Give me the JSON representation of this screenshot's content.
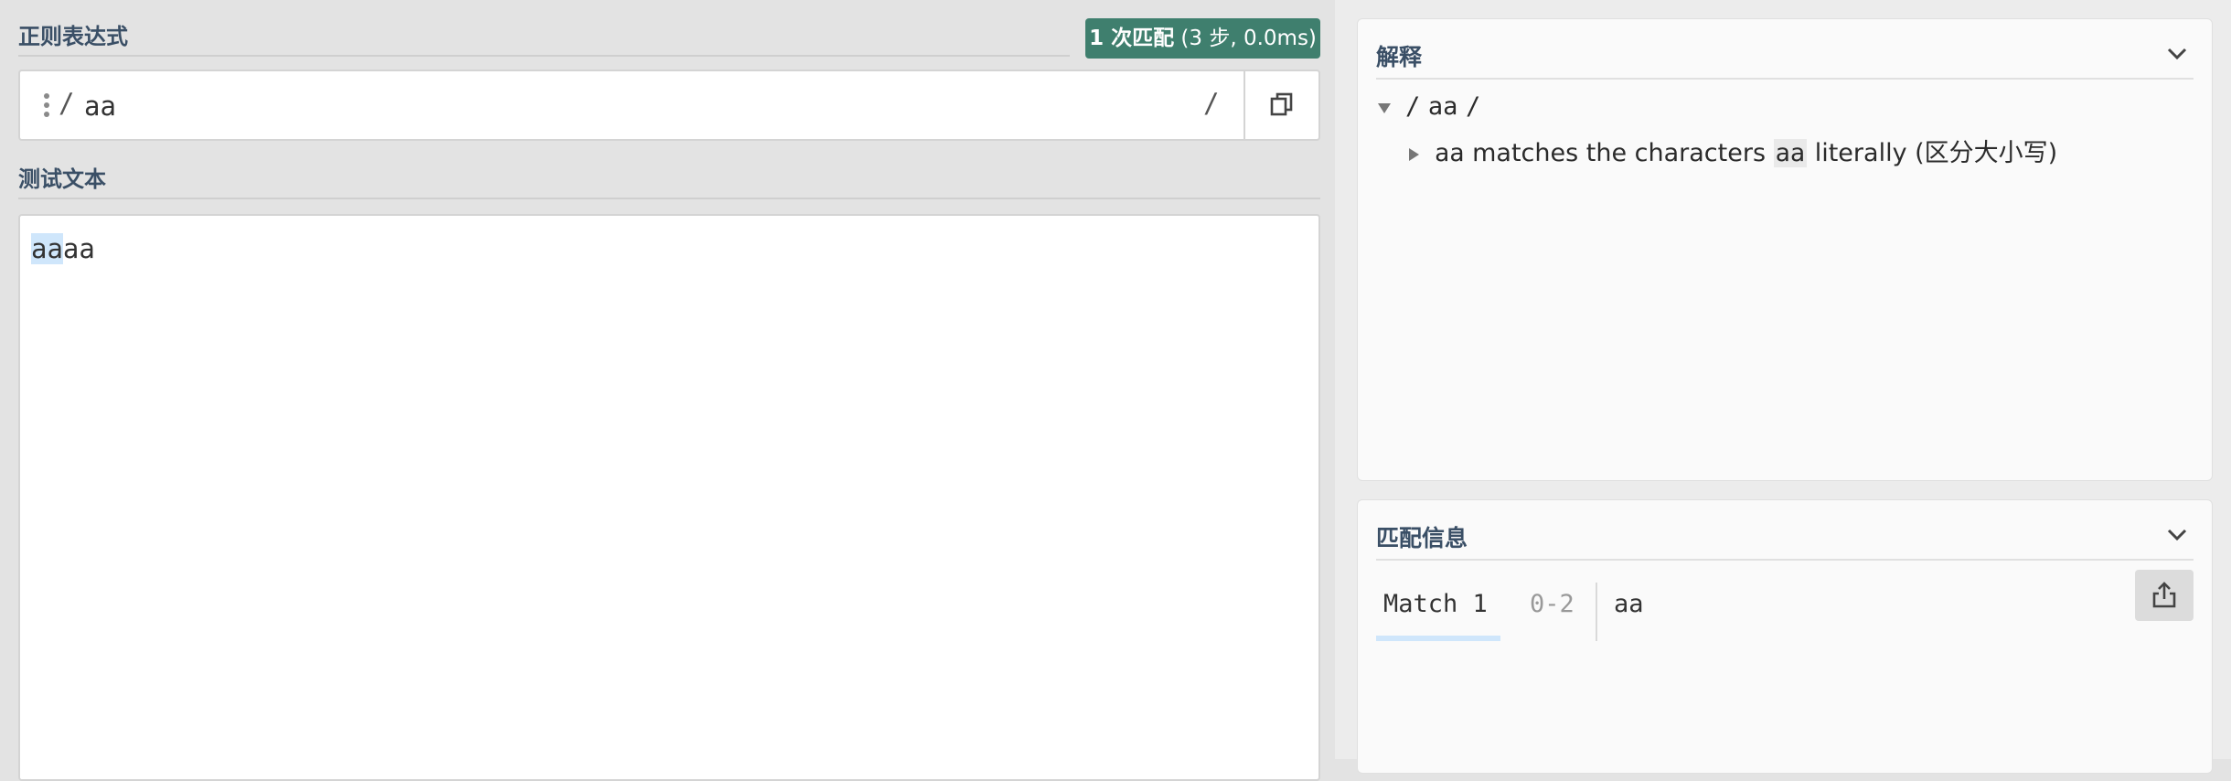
{
  "regex_section": {
    "title": "正则表达式",
    "match_badge_bold": "1 次匹配",
    "match_badge_detail": "(3 步, 0.0ms)",
    "open_delimiter": "/",
    "pattern": "aa",
    "close_delimiter": "/"
  },
  "test_section": {
    "title": "测试文本",
    "text_highlight": "aa",
    "text_rest": "aa"
  },
  "explanation_panel": {
    "title": "解释",
    "root_open": "/",
    "root_pattern": "aa",
    "root_close": "/",
    "item_token": "aa",
    "item_text_before": "matches the characters",
    "item_literal": "aa",
    "item_text_after": "literally (区分大小写)"
  },
  "match_panel": {
    "title": "匹配信息",
    "match_label": "Match 1",
    "match_range": "0-2",
    "match_value": "aa"
  },
  "icons": [
    "drag-handle-icon",
    "copy-icon",
    "chevron-down-icon",
    "triangle-down-icon",
    "triangle-right-icon",
    "share-icon"
  ],
  "colors": {
    "accent_badge": "#3f7f6e",
    "match_highlight": "#cfe6fb",
    "section_title": "#3a4f66"
  }
}
